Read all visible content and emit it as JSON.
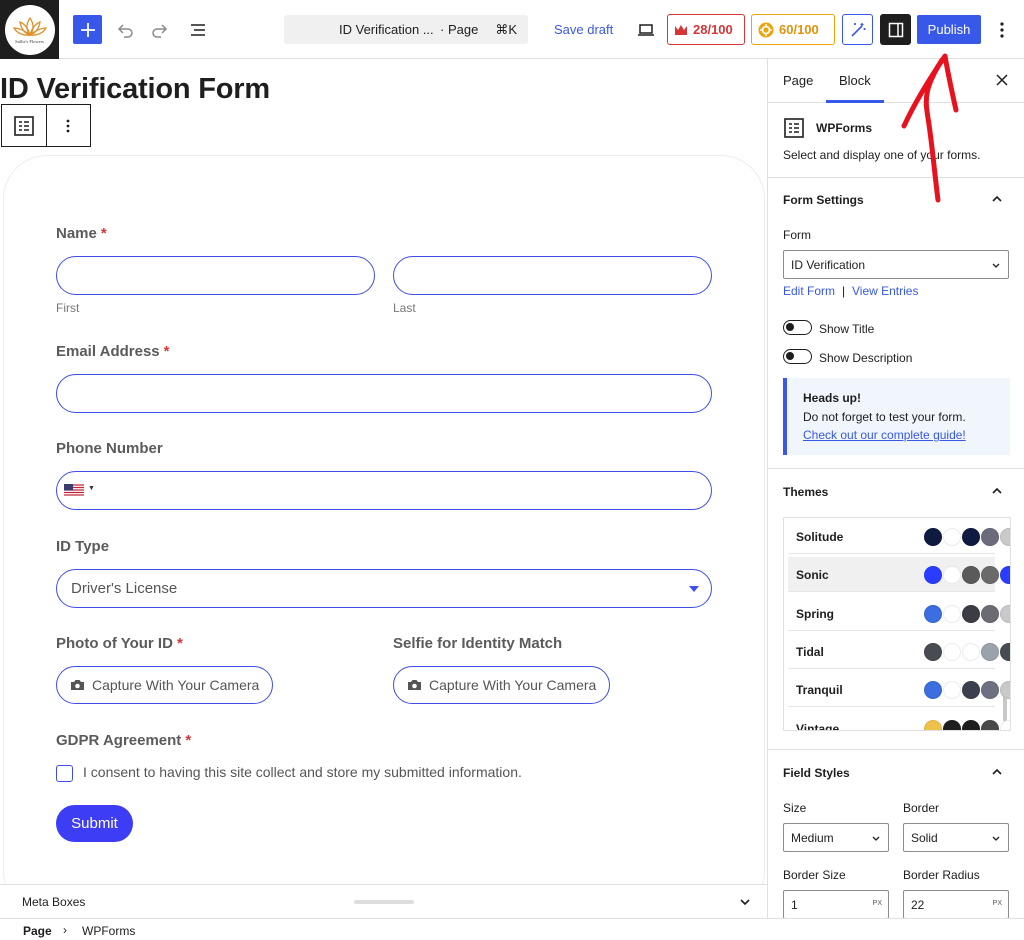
{
  "toolbar": {
    "logo_text": "Sullie's Flowers",
    "doc_title": "ID Verification ...",
    "doc_type": "· Page",
    "shortcut": "⌘K",
    "save_draft": "Save draft",
    "seo_score": "28/100",
    "ai_score": "60/100",
    "publish": "Publish"
  },
  "editor": {
    "page_title": "ID Verification Form"
  },
  "form": {
    "name_label": "Name",
    "required_mark": "*",
    "first_sublabel": "First",
    "last_sublabel": "Last",
    "email_label": "Email Address",
    "phone_label": "Phone Number",
    "id_type_label": "ID Type",
    "id_type_value": "Driver's License",
    "photo_label": "Photo of Your ID",
    "selfie_label": "Selfie for Identity Match",
    "capture_label": "Capture With Your Camera",
    "gdpr_label": "GDPR Agreement",
    "consent_text": "I consent to having this site collect and store my submitted information.",
    "submit": "Submit"
  },
  "meta": {
    "label": "Meta Boxes"
  },
  "breadcrumb": {
    "page": "Page",
    "separator": "›",
    "block": "WPForms"
  },
  "sidebar": {
    "tab_page": "Page",
    "tab_block": "Block",
    "block_title": "WPForms",
    "block_desc": "Select and display one of your forms.",
    "form_settings_title": "Form Settings",
    "form_label": "Form",
    "form_value": "ID Verification",
    "edit_form": "Edit Form",
    "link_sep": "|",
    "view_entries": "View Entries",
    "show_title": "Show Title",
    "show_description": "Show Description",
    "notice_title": "Heads up!",
    "notice_body": "Do not forget to test your form.",
    "notice_link": "Check out our complete guide!",
    "themes_title": "Themes",
    "themes": [
      {
        "name": "Solitude",
        "colors": [
          "#0e1a3f",
          "#ffffff",
          "#0e1a3f",
          "#6b6b7b",
          "#c9c9c9"
        ]
      },
      {
        "name": "Sonic",
        "colors": [
          "#2a3dff",
          "#ffffff",
          "#5a5a5a",
          "#6a6a6a",
          "#2a3dff"
        ]
      },
      {
        "name": "Spring",
        "colors": [
          "#3b6ee0",
          "#ffffff",
          "#3c3c44",
          "#6b6b74",
          "#c9c9c9"
        ]
      },
      {
        "name": "Tidal",
        "colors": [
          "#474b52",
          "#ffffff",
          "#ffffff",
          "#9aa2ab",
          "#474b52"
        ]
      },
      {
        "name": "Tranquil",
        "colors": [
          "#3d6ee0",
          "#ffffff",
          "#3c3f4f",
          "#6d7080",
          "#c9c9c9"
        ]
      },
      {
        "name": "Vintage",
        "colors": [
          "#f0c04c",
          "#1e1e1e",
          "#1e1e1e",
          "#4a4a4a",
          "#ffffff"
        ]
      }
    ],
    "field_styles_title": "Field Styles",
    "size_label": "Size",
    "size_value": "Medium",
    "border_label": "Border",
    "border_value": "Solid",
    "border_size_label": "Border Size",
    "border_size_value": "1",
    "border_radius_label": "Border Radius",
    "border_radius_value": "22",
    "unit": "PX"
  },
  "colors": {
    "wp_blue": "#3858e9",
    "form_accent": "#3d4fe6",
    "required_red": "#d63638",
    "seo_red": "#d63638",
    "ai_orange": "#f0a30b"
  }
}
